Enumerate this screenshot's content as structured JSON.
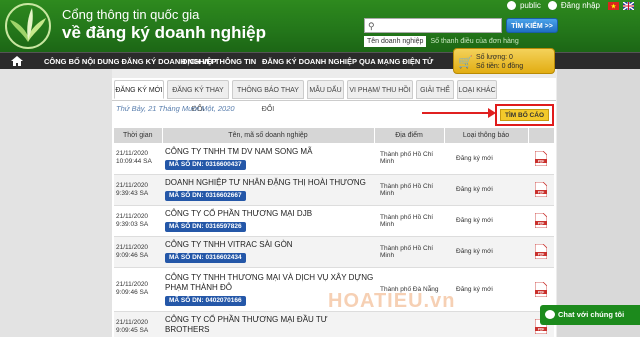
{
  "header": {
    "title_line1": "Cổng thông tin quốc gia",
    "title_line2": "về đăng ký doanh nghiệp",
    "user_label": "public",
    "login_label": "Đăng nhập",
    "search_button": "TÌM KIẾM >>",
    "search_tabs": [
      "Tên doanh nghiệp",
      "Số thanh điều của đơn hàng"
    ]
  },
  "nav": {
    "items": [
      "CÔNG BỐ NỘI DUNG ĐĂNG KÝ DOANH NGHIỆP",
      "DỊCH VỤ THÔNG TIN",
      "ĐĂNG KÝ DOANH NGHIỆP QUA MẠNG ĐIỆN TỬ"
    ]
  },
  "cart": {
    "qty": "Số lượng: 0",
    "amount": "Số tiền: 0 đồng"
  },
  "tabs": [
    "ĐĂNG KÝ MỚI",
    "ĐĂNG KÝ THAY ĐỔI",
    "THÔNG BÁO THAY ĐỔI",
    "MẪU DẤU",
    "VI PHẠM/ THU HỒI",
    "GIẢI THỂ",
    "LOẠI KHÁC"
  ],
  "date_text": "Thứ Bảy, 21 Tháng Mười Một, 2020",
  "find_report_button": "TÌM BỐ CÁO",
  "table": {
    "headers": [
      "Thời gian",
      "Tên, mã số doanh nghiệp",
      "Địa điểm",
      "Loại thông báo",
      ""
    ],
    "rows": [
      {
        "date": "21/11/2020",
        "time": "10:09:44 SA",
        "name": "CÔNG TY TNHH TM DV NAM SONG MÃ",
        "code": "MÃ SỐ DN: 0316600437",
        "place": "Thành phố Hồ Chí Minh",
        "kind": "Đăng ký mới"
      },
      {
        "date": "21/11/2020",
        "time": "9:39:43 SA",
        "name": "DOANH NGHIỆP TƯ NHÂN ĐẶNG THỊ HOÀI THƯƠNG",
        "code": "MÃ SỐ DN: 0316602667",
        "place": "Thành phố Hồ Chí Minh",
        "kind": "Đăng ký mới"
      },
      {
        "date": "21/11/2020",
        "time": "9:39:03 SA",
        "name": "CÔNG TY CỔ PHẦN THƯƠNG MẠI DJB",
        "code": "MÃ SỐ DN: 0316597826",
        "place": "Thành phố Hồ Chí Minh",
        "kind": "Đăng ký mới"
      },
      {
        "date": "21/11/2020",
        "time": "9:09:46 SA",
        "name": "CÔNG TY TNHH VITRAC SÀI GÒN",
        "code": "MÃ SỐ DN: 0316602434",
        "place": "Thành phố Hồ Chí Minh",
        "kind": "Đăng ký mới"
      },
      {
        "date": "21/11/2020",
        "time": "9:09:46 SA",
        "name": "CÔNG TY TNHH THƯƠNG MẠI VÀ DỊCH VỤ XÂY DỰNG PHẠM THÀNH ĐÔ",
        "code": "MÃ SỐ DN: 0402070166",
        "place": "Thành phố Đà Nẵng",
        "kind": "Đăng ký mới"
      },
      {
        "date": "21/11/2020",
        "time": "9:09:45 SA",
        "name": "CÔNG TY CỔ PHẦN THƯƠNG MẠI ĐẦU TƯ BROTHERS",
        "code": "",
        "place": "",
        "kind": ""
      }
    ]
  },
  "watermark": "HOATIEU.vn",
  "chat_label": "Chat với chúng tôi",
  "colors": {
    "header_green": "#23761a",
    "navbar": "#2b2b2b",
    "msdn_blue": "#2457a8",
    "highlight_red": "#e01b1b",
    "button_yellow": "#f3c92b"
  }
}
